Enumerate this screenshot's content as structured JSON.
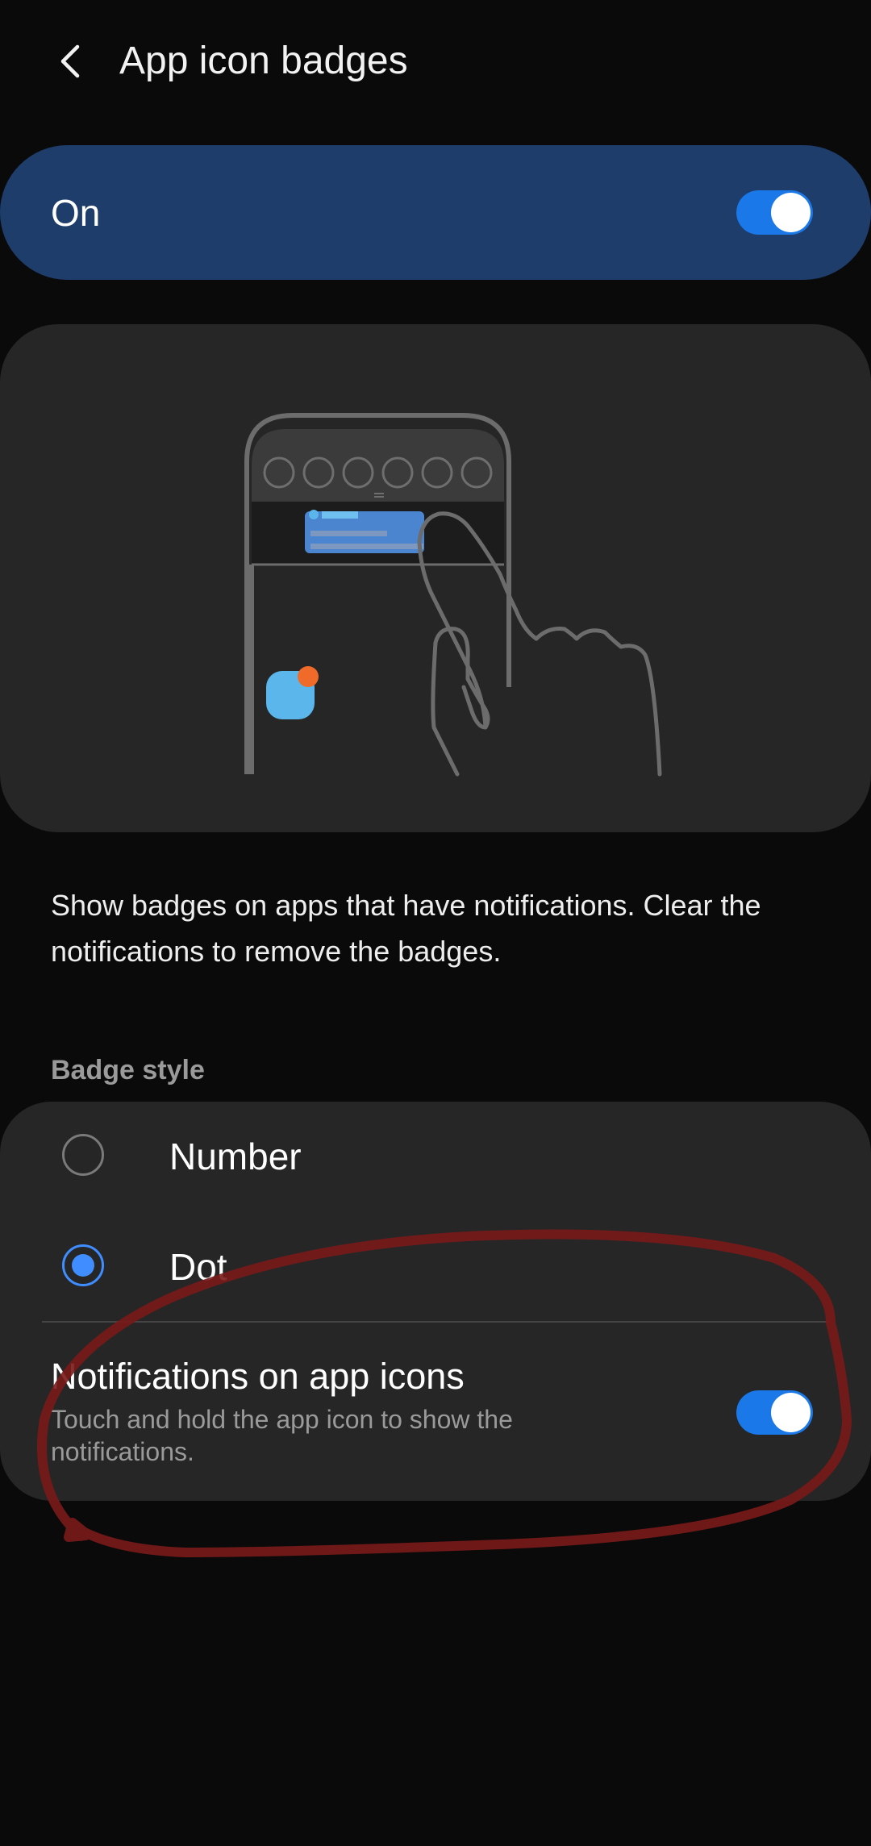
{
  "header": {
    "back_icon": "chevron-left-icon",
    "title": "App icon badges"
  },
  "master_switch": {
    "label": "On",
    "state": "on",
    "accent_color": "#1a78e8",
    "background_color": "#1e3d6b"
  },
  "illustration": {
    "icon": "phone-hand-swipe-illustration",
    "badge_color": "#f06b2a",
    "app_icon_color": "#5bb6ec"
  },
  "description": "Show badges on apps that have notifications. Clear the notifications to remove the badges.",
  "badge_style": {
    "section_label": "Badge style",
    "options": [
      {
        "label": "Number",
        "selected": false
      },
      {
        "label": "Dot",
        "selected": true
      }
    ],
    "selected_color": "#3f8dff"
  },
  "notifications_on_icons": {
    "title": "Notifications on app icons",
    "subtitle": "Touch and hold the app icon to show the notifications.",
    "state": "on"
  },
  "annotation": {
    "shape": "hand-drawn-ellipse",
    "color": "#7a1a1a"
  }
}
